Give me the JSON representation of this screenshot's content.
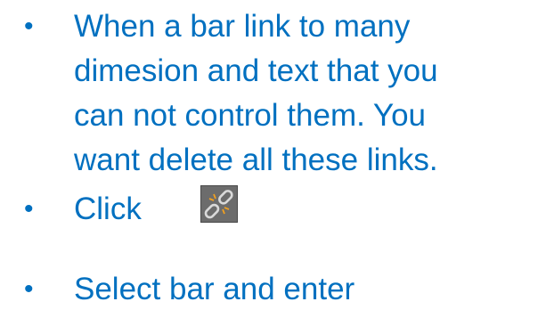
{
  "bullets": [
    {
      "marker": "•",
      "lines": [
        "When a bar link to many",
        "dimesion and text that you",
        "can not control them. You",
        "want delete all these links."
      ]
    },
    {
      "marker": "•",
      "text": "Click",
      "icon": "break-link-icon"
    },
    {
      "marker": "•",
      "text": "Select bar and enter"
    }
  ],
  "colors": {
    "text": "#0070c0",
    "background": "#ffffff",
    "icon_background": "#6c6c6c"
  }
}
